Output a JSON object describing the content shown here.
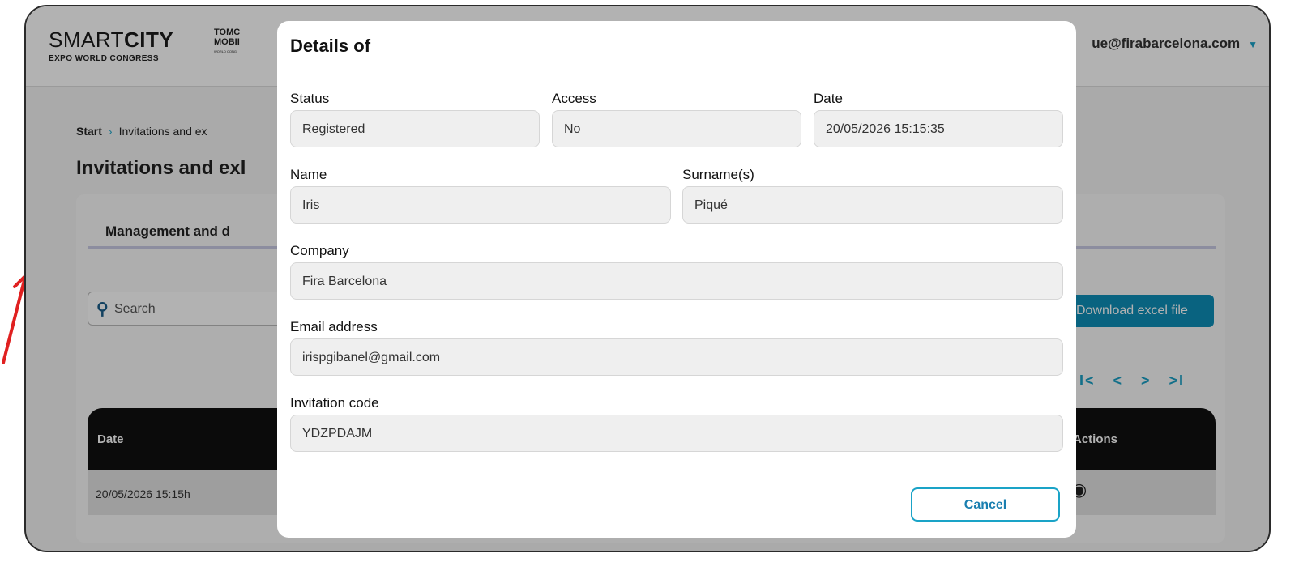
{
  "header": {
    "logo_main_light": "SMART",
    "logo_main_bold": "CITY",
    "logo_sub": "EXPO WORLD CONGRESS",
    "logo2_line1": "TOMC",
    "logo2_line2": "MOBII",
    "logo2_line3": "WORLD CONG",
    "user_email": "ue@firabarcelona.com",
    "accent_color": "#1aa3c7"
  },
  "breadcrumb": {
    "start": "Start",
    "current": "Invitations and ex"
  },
  "page_title": "Invitations and exl",
  "tab_title": "Management and d",
  "search": {
    "placeholder": "Search"
  },
  "download_button": "Download excel file",
  "pager": {
    "first": "I<",
    "prev": "<",
    "next": ">",
    "last": ">I"
  },
  "table": {
    "columns": [
      "Date",
      "Actions"
    ],
    "rows": [
      {
        "date": "20/05/2026 15:15h"
      }
    ]
  },
  "modal": {
    "title": "Details of",
    "status_label": "Status",
    "status_value": "Registered",
    "access_label": "Access",
    "access_value": "No",
    "date_label": "Date",
    "date_value": "20/05/2026 15:15:35",
    "name_label": "Name",
    "name_value": "Iris",
    "surname_label": "Surname(s)",
    "surname_value": "Piqué",
    "company_label": "Company",
    "company_value": "Fira Barcelona",
    "email_label": "Email address",
    "email_value": "irispgibanel@gmail.com",
    "code_label": "Invitation code",
    "code_value": "YDZPDAJM",
    "cancel_label": "Cancel"
  }
}
